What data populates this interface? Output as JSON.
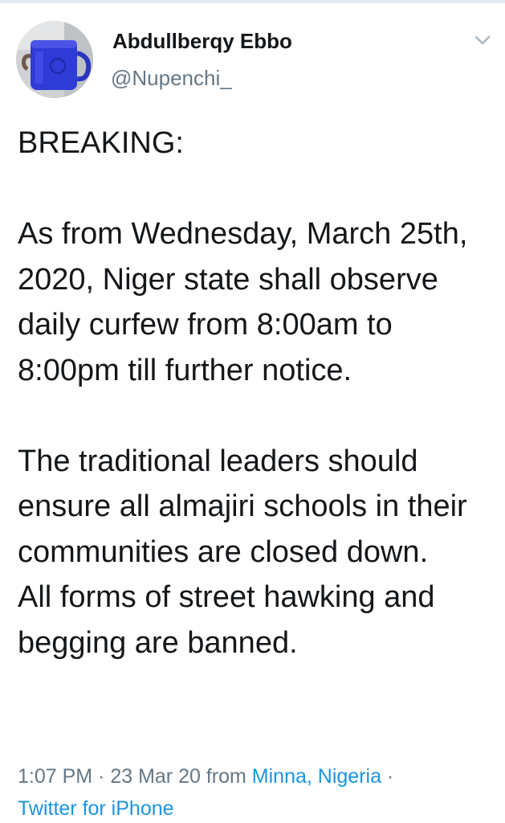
{
  "author": {
    "display_name": "Abdullberqy Ebbo",
    "handle": "@Nupenchi_",
    "avatar_icon": "mug-photo-avatar"
  },
  "tweet": {
    "paragraphs": [
      "BREAKING:",
      "As from Wednesday, March 25th, 2020, Niger state shall observe daily curfew from 8:00am to 8:00pm till further notice.",
      "The traditional leaders should ensure all almajiri schools in their communities are closed down.\nAll forms of street hawking and begging are banned."
    ]
  },
  "meta": {
    "time": "1:07 PM",
    "separator": " · ",
    "date": "23 Mar 20",
    "from_label": "from",
    "location": "Minna, Nigeria",
    "separator2": " ·",
    "source": "Twitter for iPhone"
  },
  "colors": {
    "text": "#14171a",
    "secondary": "#657786",
    "link": "#1b95e0",
    "divider": "#e6ecf0"
  }
}
